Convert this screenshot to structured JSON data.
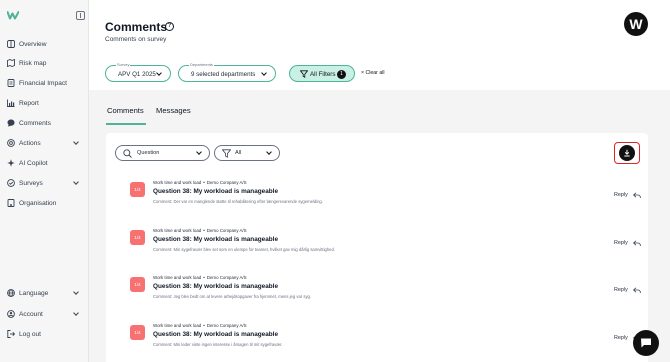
{
  "sidebar": {
    "items": [
      {
        "label": "Overview",
        "icon": "grid-icon"
      },
      {
        "label": "Risk map",
        "icon": "map-icon"
      },
      {
        "label": "Financial Impact",
        "icon": "document-icon"
      },
      {
        "label": "Report",
        "icon": "chart-icon"
      },
      {
        "label": "Comments",
        "icon": "comment-icon"
      },
      {
        "label": "Actions",
        "icon": "target-icon"
      },
      {
        "label": "AI Copilot",
        "icon": "sparkle-icon"
      },
      {
        "label": "Surveys",
        "icon": "survey-icon"
      },
      {
        "label": "Organisation",
        "icon": "building-icon"
      }
    ],
    "bottom": [
      {
        "label": "Language",
        "icon": "globe-icon"
      },
      {
        "label": "Account",
        "icon": "user-icon"
      },
      {
        "label": "Log out",
        "icon": "logout-icon"
      }
    ]
  },
  "header": {
    "title": "Comments",
    "subtitle": "Comments on survey",
    "avatar_letter": "W",
    "survey_caption": "Survey",
    "survey_value": "APV Q1 2025",
    "departments_caption": "Departments",
    "departments_value": "9 selected departments",
    "filters_label": "All Filters",
    "filters_count": "1",
    "clear_all": "Clear all"
  },
  "tabs": [
    {
      "label": "Comments",
      "active": true
    },
    {
      "label": "Messages",
      "active": false
    }
  ],
  "toolbar": {
    "question_placeholder": "Question",
    "filter_value": "All"
  },
  "comments": [
    {
      "score": "1/4",
      "category": "Work time and work load",
      "company": "Demo Company A/S",
      "question": "Question 38: My workload is manageable",
      "comment": "Comment: Der var en manglende støtte til rehabilitering efter længerevarende sygemelding.",
      "reply": "Reply"
    },
    {
      "score": "1/4",
      "category": "Work time and work load",
      "company": "Demo Company A/S",
      "question": "Question 38: My workload is manageable",
      "comment": "Comment: Min sygefravær blev set som en ulempe for teamet, hvilket gav mig dårlig samvittighed.",
      "reply": "Reply"
    },
    {
      "score": "1/4",
      "category": "Work time and work load",
      "company": "Demo Company A/S",
      "question": "Question 38: My workload is manageable",
      "comment": "Comment: Jeg blev bedt om at levere arbejdsopgaver fra hjemmet, mens jeg var syg.",
      "reply": "Reply"
    },
    {
      "score": "1/4",
      "category": "Work time and work load",
      "company": "Demo Company A/S",
      "question": "Question 38: My workload is manageable",
      "comment": "Comment: Min leder viste ingen interesse i årsagen til mit sygefravær.",
      "reply": "Reply"
    }
  ],
  "colors": {
    "accent": "#4fb39a",
    "accent_light": "#c9f0e4",
    "score_badge": "#f87171",
    "highlight_border": "#dc2626"
  }
}
